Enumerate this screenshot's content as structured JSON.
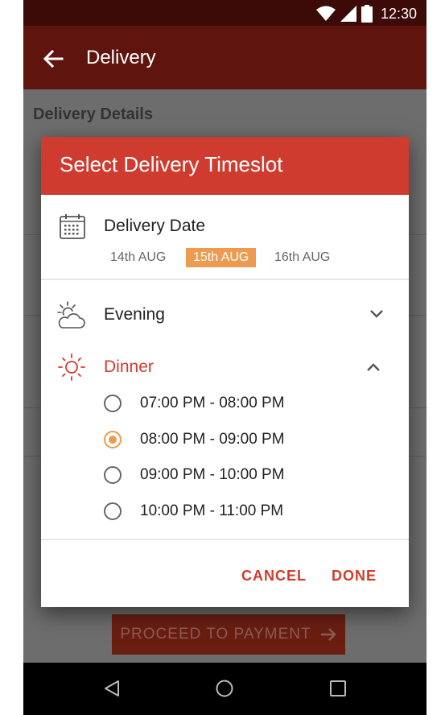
{
  "status_bar": {
    "time": "12:30",
    "icons": [
      "wifi-icon",
      "signal-icon",
      "battery-icon"
    ]
  },
  "app_bar": {
    "title": "Delivery",
    "back_icon": "arrow-left-icon"
  },
  "background": {
    "section_title": "Delivery Details",
    "proceed_button": "PROCEED TO PAYMENT"
  },
  "dialog": {
    "title": "Select Delivery Timeslot",
    "date": {
      "label": "Delivery Date",
      "options": [
        "14th AUG",
        "15th AUG",
        "16th AUG"
      ],
      "selected": "15th AUG"
    },
    "groups": [
      {
        "label": "Evening",
        "expanded": false,
        "icon": "cloud-sun-icon"
      },
      {
        "label": "Dinner",
        "expanded": true,
        "icon": "sun-icon"
      }
    ],
    "slots": [
      {
        "label": "07:00 PM - 08:00 PM",
        "selected": false
      },
      {
        "label": "08:00 PM - 09:00 PM",
        "selected": true
      },
      {
        "label": "09:00 PM - 10:00 PM",
        "selected": false
      },
      {
        "label": "10:00 PM - 11:00 PM",
        "selected": false
      }
    ],
    "actions": {
      "cancel": "CANCEL",
      "done": "DONE"
    }
  },
  "colors": {
    "accent": "#cf3c2f",
    "selection": "#ec9b50",
    "app_bar": "#5f150d"
  },
  "nav_bar": {
    "icons": [
      "nav-back-icon",
      "nav-home-icon",
      "nav-recents-icon"
    ]
  }
}
